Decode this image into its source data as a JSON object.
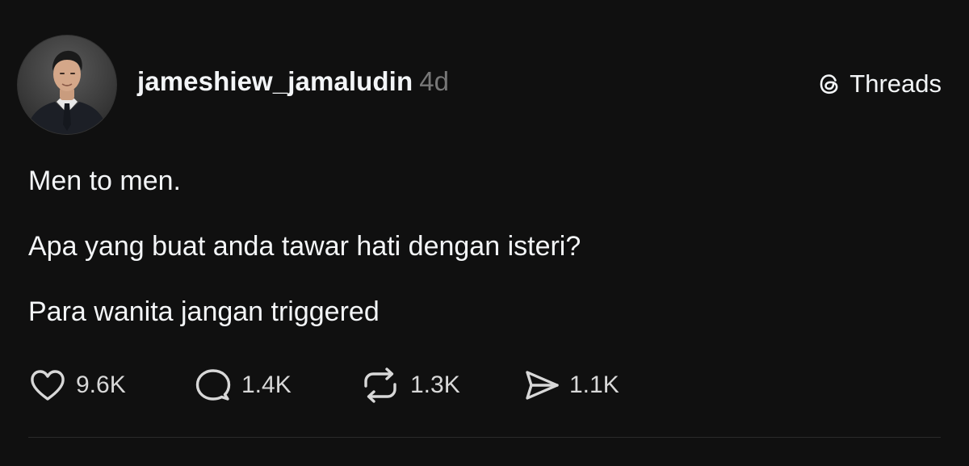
{
  "post": {
    "username": "jameshiew_jamaludin",
    "timestamp": "4d",
    "brand_label": "Threads",
    "lines": [
      "Men to men.",
      "Apa yang buat anda tawar hati dengan isteri?",
      "Para wanita jangan triggered"
    ],
    "stats": {
      "likes": "9.6K",
      "replies": "1.4K",
      "reposts": "1.3K",
      "shares": "1.1K"
    }
  },
  "icons": {
    "like": "heart-icon",
    "reply": "speech-bubble-icon",
    "repost": "repost-arrows-icon",
    "share": "paper-plane-icon",
    "brand": "threads-logo-icon"
  },
  "colors": {
    "background": "#101010",
    "text": "#f3f5f7",
    "muted": "#777777"
  }
}
